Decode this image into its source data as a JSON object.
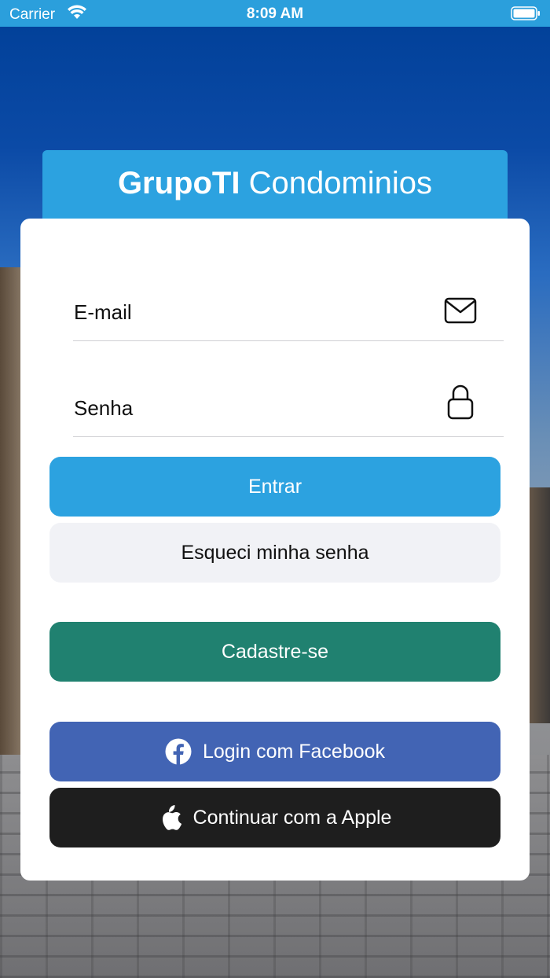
{
  "status_bar": {
    "carrier": "Carrier",
    "time": "8:09 AM"
  },
  "header": {
    "title_bold": "GrupoTI",
    "title_regular": "Condominios"
  },
  "form": {
    "email_label": "E-mail",
    "password_label": "Senha"
  },
  "buttons": {
    "enter": "Entrar",
    "forgot": "Esqueci minha senha",
    "register": "Cadastre-se",
    "facebook": "Login com Facebook",
    "apple": "Continuar com a Apple"
  },
  "colors": {
    "status_bar": "#2b9fdc",
    "primary": "#2ca2e0",
    "register": "#208170",
    "facebook": "#4264b4",
    "apple": "#1e1e1e",
    "secondary": "#f1f2f6"
  },
  "icons": {
    "email": "envelope-icon",
    "password": "lock-icon",
    "facebook": "facebook-icon",
    "apple": "apple-icon",
    "wifi": "wifi-icon",
    "battery": "battery-icon"
  }
}
